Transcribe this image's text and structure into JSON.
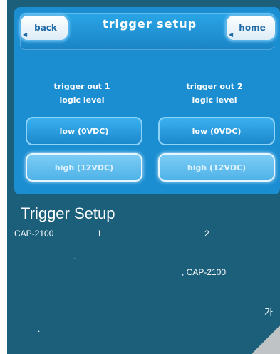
{
  "screen": {
    "title": "trigger setup",
    "back_label": "back",
    "home_label": "home",
    "columns": [
      {
        "line1": "trigger out 1",
        "line2": "logic level",
        "low": "low (0VDC)",
        "high": "high (12VDC)"
      },
      {
        "line1": "trigger out 2",
        "line2": "logic level",
        "low": "low (0VDC)",
        "high": "high (12VDC)"
      }
    ]
  },
  "description": {
    "heading": "Trigger Setup",
    "model_1": "CAP-2100",
    "num_1": "1",
    "num_2": "2",
    "dot_1": ".",
    "model_2": ", CAP-2100",
    "ga": "가",
    "dot_2": "."
  }
}
